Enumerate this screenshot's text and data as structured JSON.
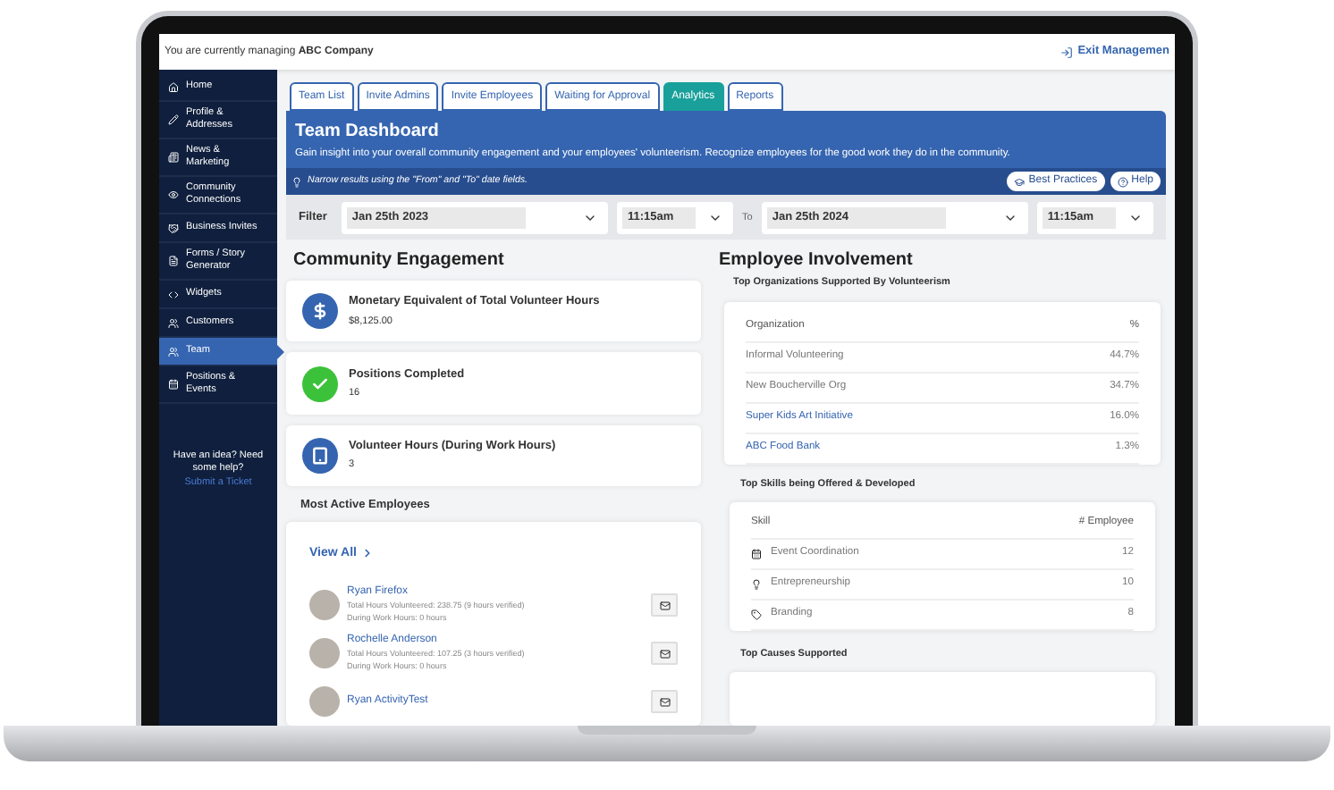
{
  "top_bar": {
    "managing": "You are currently managing **ABC Company**",
    "exit": "Exit Managemen"
  },
  "sidebar": {
    "items": [
      {
        "label": "Home",
        "selected": false
      },
      {
        "label": "Profile & Addresses",
        "selected": false
      },
      {
        "label": "News & Marketing",
        "selected": false
      },
      {
        "label": "Community Connections",
        "selected": false
      },
      {
        "label": "Business Invites",
        "selected": false
      },
      {
        "label": "Forms / Story Generator",
        "selected": false
      },
      {
        "label": "Widgets",
        "selected": false
      },
      {
        "label": "Customers",
        "selected": false
      },
      {
        "label": "Team",
        "selected": true
      },
      {
        "label": "Positions & Events",
        "selected": false
      }
    ],
    "help_text": "Have an idea? Need some help?",
    "help_link": "Submit a Ticket"
  },
  "tabs": [
    {
      "label": "Team List",
      "selected": false
    },
    {
      "label": "Invite Admins",
      "selected": false
    },
    {
      "label": "Invite Employees",
      "selected": false
    },
    {
      "label": "Waiting for Approval",
      "selected": false
    },
    {
      "label": "Analytics",
      "selected": true
    },
    {
      "label": "Reports",
      "selected": false
    }
  ],
  "header": {
    "title": "Team Dashboard",
    "subtitle": "Gain insight into your overall community engagement and your employees' volunteerism. Recognize employees for the good work they do in the community.",
    "hint": "Narrow results using the \"From\" and \"To\" date fields.",
    "buttons": [
      {
        "kind": "practices",
        "label": "Best Practices"
      },
      {
        "kind": "help",
        "label": "Help"
      }
    ]
  },
  "filter": {
    "label": "Filter",
    "from_date": "Jan 25th 2023",
    "from_time": "11:15am",
    "to_label": "To",
    "to_date": "Jan 25th 2024",
    "to_time": "11:15am"
  },
  "community": {
    "heading": "Community Engagement",
    "stats": [
      {
        "kind": "money",
        "title": "Monetary Equivalent of Total Volunteer Hours",
        "value": "$8,125.00"
      },
      {
        "kind": "check",
        "title": "Positions Completed",
        "value": "16"
      },
      {
        "kind": "hours",
        "title": "Volunteer Hours (During Work Hours)",
        "value": "3"
      }
    ],
    "most_active": {
      "heading": "Most Active Employees",
      "view_all": "View All",
      "employees": [
        {
          "name": "Ryan Firefox",
          "total": "Total Hours Volunteered: 238.75 (9 hours verified)",
          "work": "During Work Hours: 0 hours"
        },
        {
          "name": "Rochelle Anderson",
          "total": "Total Hours Volunteered: 107.25 (3 hours verified)",
          "work": "During Work Hours: 0 hours"
        },
        {
          "name": "Ryan ActivityTest"
        }
      ]
    }
  },
  "involvement": {
    "heading": "Employee Involvement",
    "orgs": {
      "title": "Top Organizations Supported By Volunteerism",
      "columns": [
        "Organization",
        "%"
      ],
      "rows": [
        {
          "name": "Informal Volunteering",
          "percent": "44.7%",
          "linked": false
        },
        {
          "name": "New Boucherville Org",
          "percent": "34.7%",
          "linked": false
        },
        {
          "name": "Super Kids Art Initiative",
          "percent": "16.0%",
          "linked": true
        },
        {
          "name": "ABC Food Bank",
          "percent": "1.3%",
          "linked": true
        }
      ]
    },
    "skills": {
      "title": "Top Skills being Offered & Developed",
      "columns": [
        "Skill",
        "# Employee"
      ],
      "rows": [
        {
          "kind": "calendar",
          "name": "Event Coordination",
          "count": "12"
        },
        {
          "kind": "idea",
          "name": "Entrepreneurship",
          "count": "10"
        },
        {
          "kind": "tag",
          "name": "Branding",
          "count": "8"
        }
      ]
    },
    "causes": {
      "title": "Top Causes Supported"
    }
  }
}
